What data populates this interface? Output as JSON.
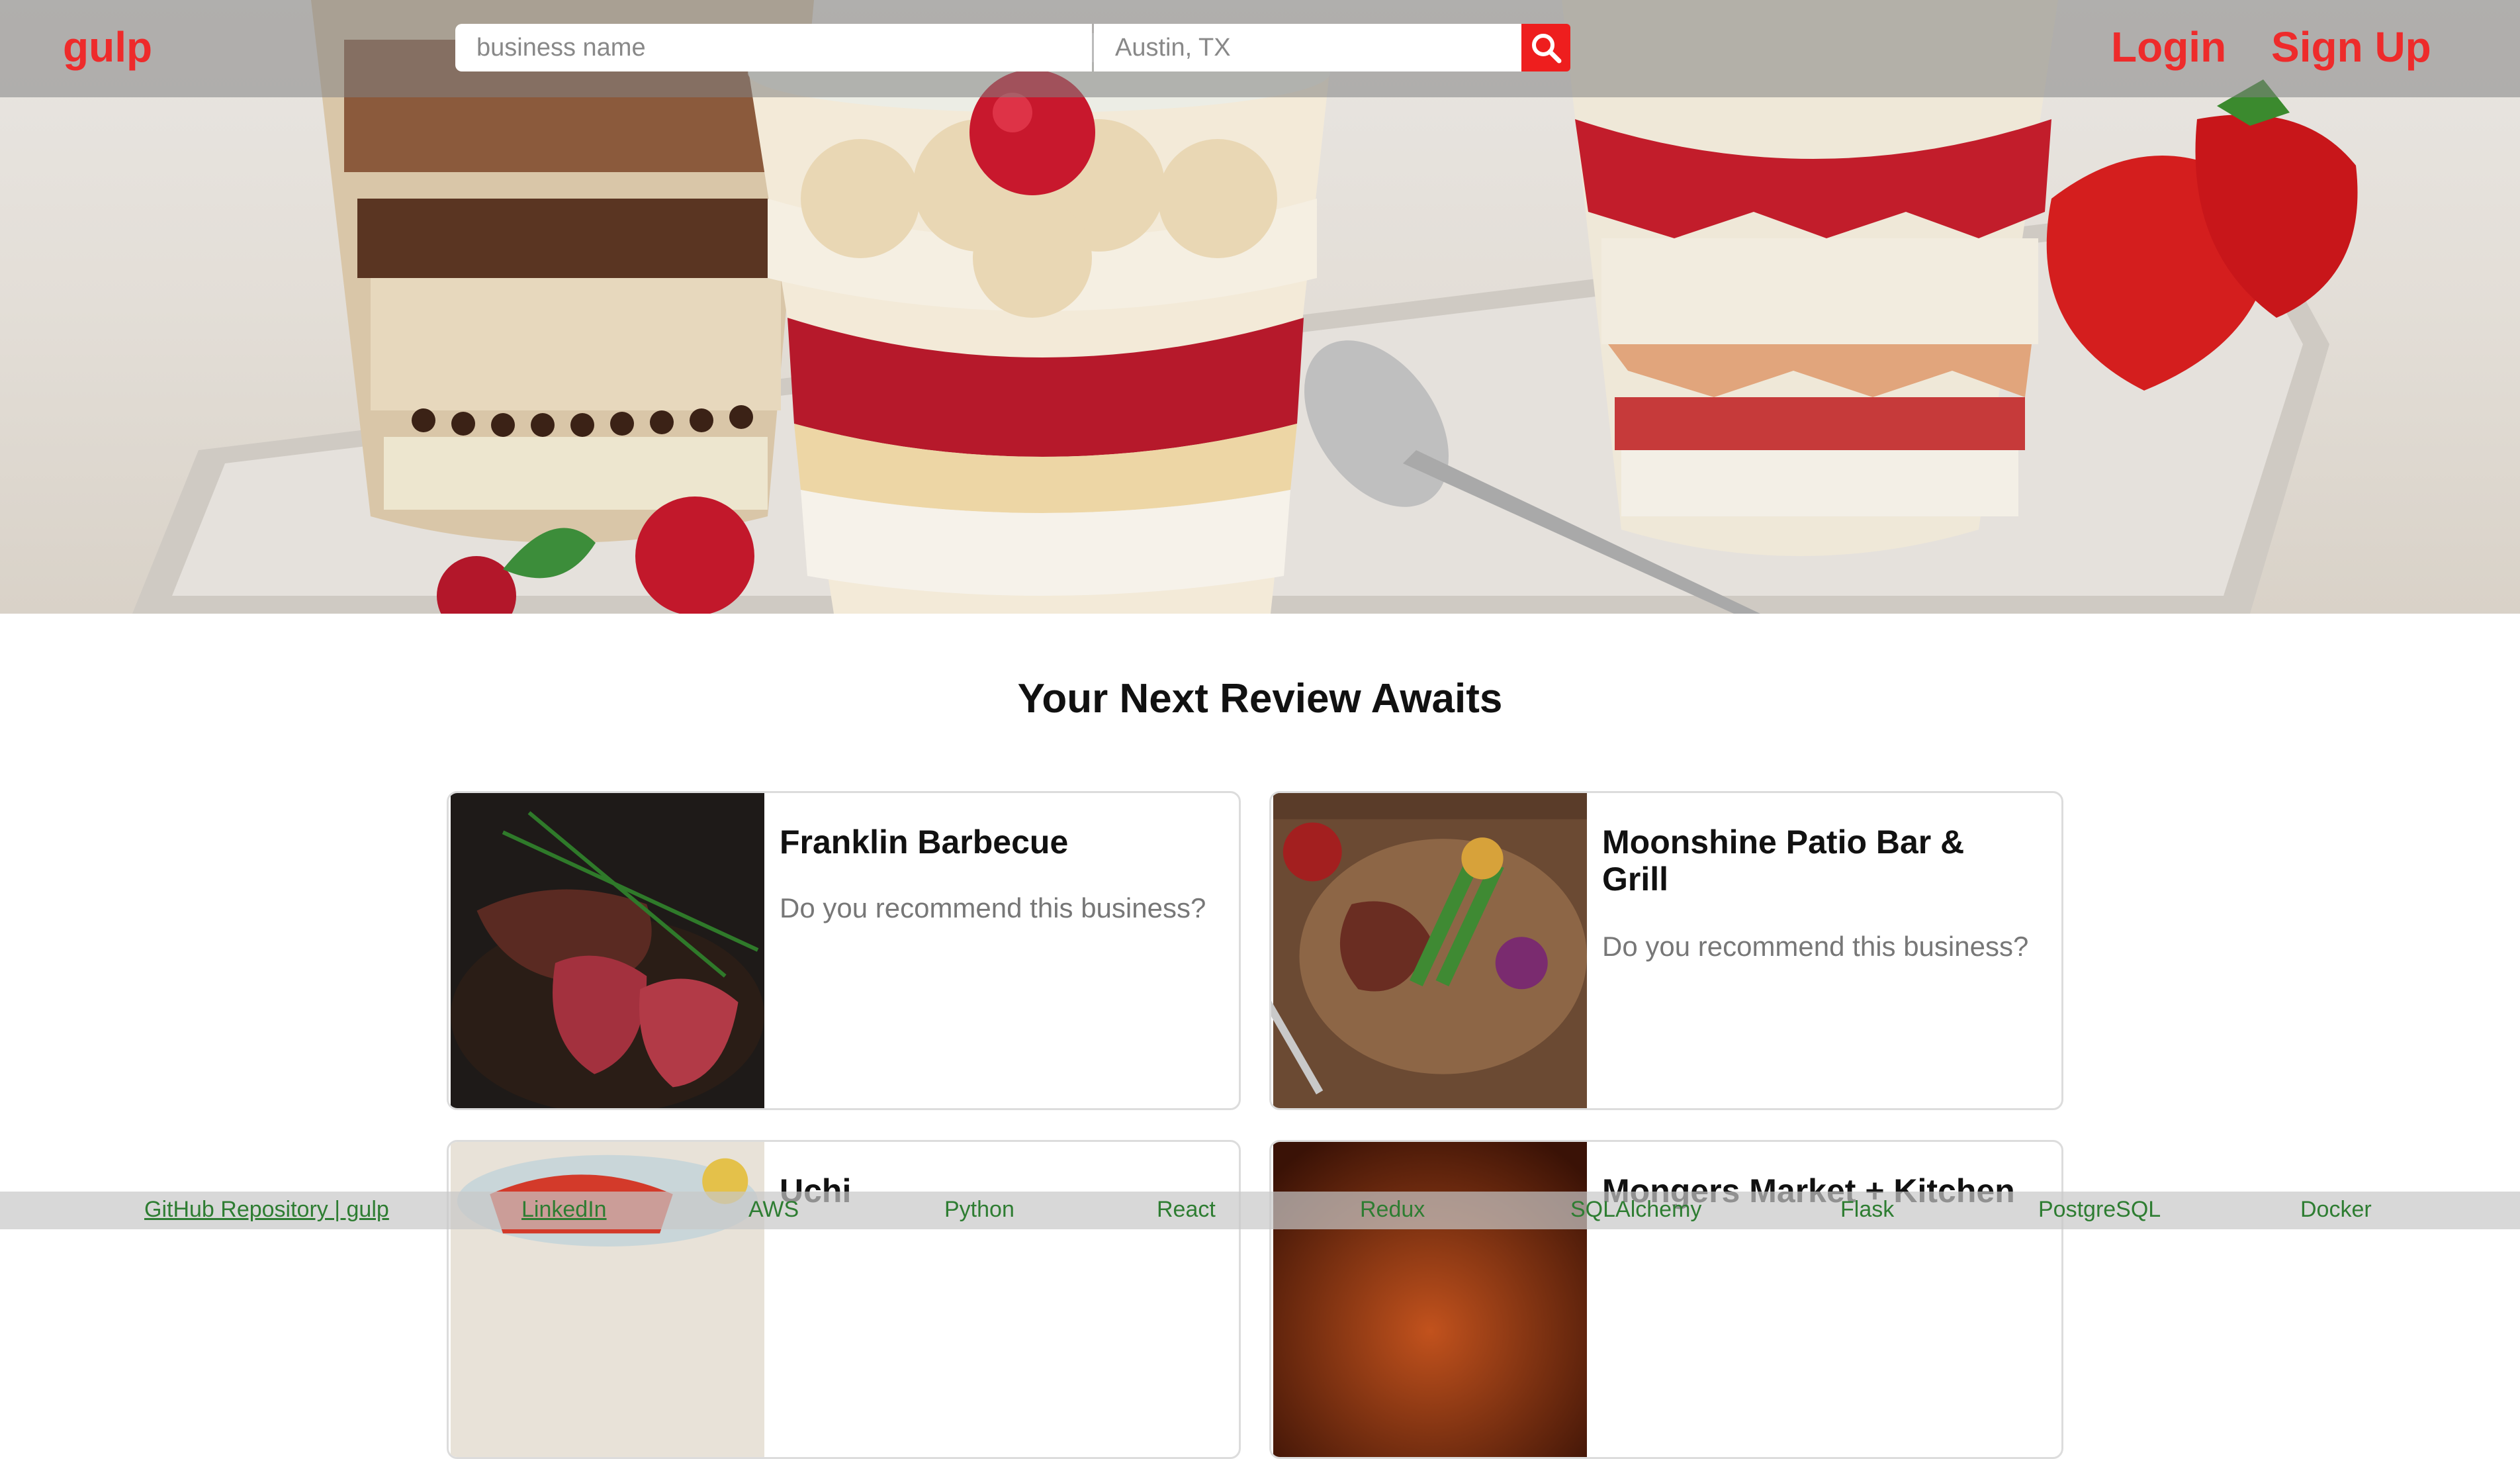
{
  "header": {
    "logo": "gulp",
    "search_business_placeholder": "business name",
    "search_location_placeholder": "Austin, TX",
    "login": "Login",
    "signup": "Sign Up"
  },
  "main": {
    "title": "Your Next Review Awaits",
    "cards": [
      {
        "name": "Franklin Barbecue",
        "prompt": "Do you recommend this business?"
      },
      {
        "name": "Moonshine Patio Bar & Grill",
        "prompt": "Do you recommend this business?"
      },
      {
        "name": "Uchi",
        "prompt": ""
      },
      {
        "name": "Mongers Market + Kitchen",
        "prompt": ""
      }
    ]
  },
  "footer": {
    "links": [
      "GitHub Repository | gulp",
      "LinkedIn",
      "AWS",
      "Python",
      "React",
      "Redux",
      "SQLAlchemy",
      "Flask",
      "PostgreSQL",
      "Docker"
    ]
  },
  "colors": {
    "accent": "#ee2b2b",
    "footer_link": "#2e7d32"
  }
}
